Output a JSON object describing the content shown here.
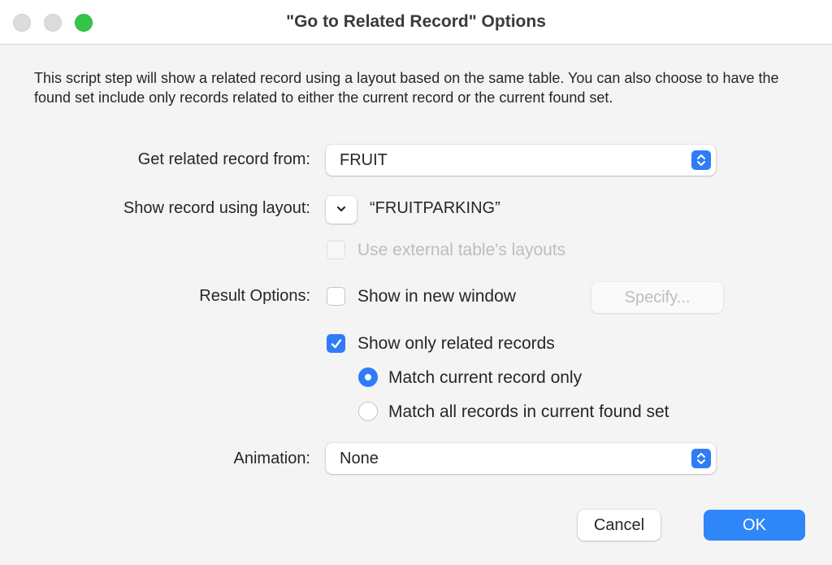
{
  "window": {
    "title": "\"Go to Related Record\" Options",
    "traffic_lights": [
      "close",
      "minimize",
      "zoom"
    ]
  },
  "description": "This script step will show a related record using a layout based on the same table.  You can also choose to have the found set include only records related to either the current record or the current found set.",
  "fields": {
    "get_related_label": "Get related record from:",
    "get_related_value": "FRUIT",
    "show_layout_label": "Show record using layout:",
    "show_layout_value": "“FRUITPARKING”",
    "use_external_label": "Use external table's layouts",
    "use_external_checked": false,
    "use_external_enabled": false,
    "result_options_label": "Result Options:",
    "show_new_window_label": "Show in new window",
    "show_new_window_checked": false,
    "specify_label": "Specify...",
    "show_only_related_label": "Show only related records",
    "show_only_related_checked": true,
    "radio_options": [
      {
        "label": "Match current record only",
        "selected": true
      },
      {
        "label": "Match all records in current found set",
        "selected": false
      }
    ],
    "animation_label": "Animation:",
    "animation_value": "None"
  },
  "buttons": {
    "cancel": "Cancel",
    "ok": "OK"
  },
  "colors": {
    "accent": "#2f7cf6",
    "zoom_light": "#33c748"
  }
}
